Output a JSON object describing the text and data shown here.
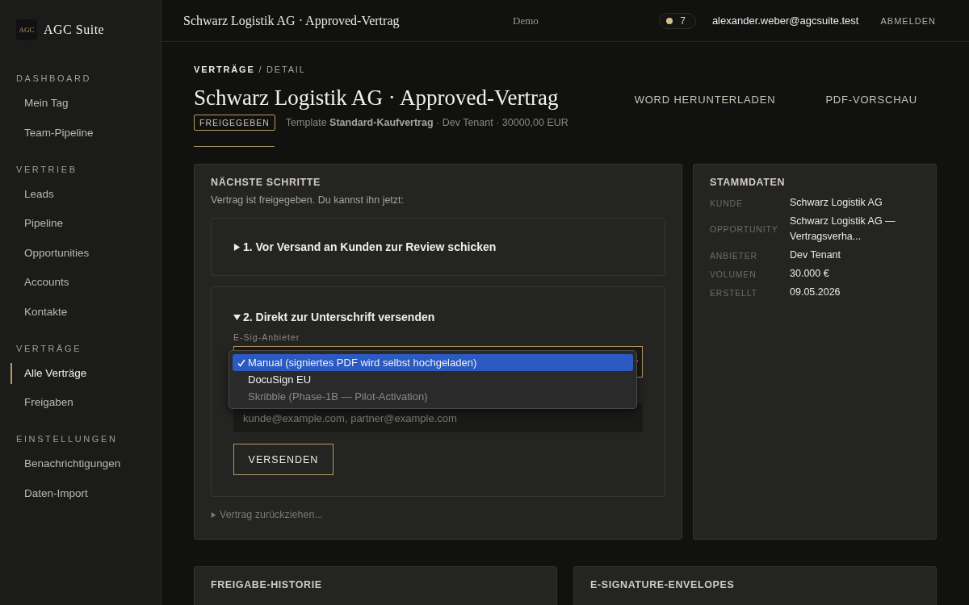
{
  "sidebar": {
    "logo_mark": "AGC",
    "brand": "AGC Suite",
    "sections": [
      {
        "title": "DASHBOARD",
        "items": [
          {
            "label": "Mein Tag",
            "selected": false
          },
          {
            "label": "Team-Pipeline",
            "selected": false
          }
        ]
      },
      {
        "title": "VERTRIEB",
        "items": [
          {
            "label": "Leads",
            "selected": false
          },
          {
            "label": "Pipeline",
            "selected": false
          },
          {
            "label": "Opportunities",
            "selected": false
          },
          {
            "label": "Accounts",
            "selected": false
          },
          {
            "label": "Kontakte",
            "selected": false
          }
        ]
      },
      {
        "title": "VERTRÄGE",
        "items": [
          {
            "label": "Alle Verträge",
            "selected": true
          },
          {
            "label": "Freigaben",
            "selected": false
          }
        ]
      },
      {
        "title": "EINSTELLUNGEN",
        "items": [
          {
            "label": "Benachrichtigungen",
            "selected": false
          },
          {
            "label": "Daten-Import",
            "selected": false
          }
        ]
      }
    ]
  },
  "topbar": {
    "title": "Schwarz Logistik AG · Approved-Vertrag",
    "environment": "Demo",
    "notifications": "7",
    "user": "alexander.weber@agcsuite.test",
    "logout": "ABMELDEN"
  },
  "header": {
    "breadcrumb": [
      "VERTRÄGE",
      "DETAIL"
    ],
    "breadcrumb_separator": "/",
    "title": "Schwarz Logistik AG · Approved-Vertrag",
    "status": "FREIGEGEBEN",
    "meta": "Template **Standard-Kaufvertrag** · Dev Tenant · 30000,00 EUR",
    "actions": [
      "WORD HERUNTERLADEN",
      "PDF-VORSCHAU"
    ]
  },
  "next_steps": {
    "title": "NÄCHSTE SCHRITTE",
    "intro": "Vertrag ist freigegeben. Du kannst ihn jetzt:",
    "steps": [
      {
        "label": "1. Vor Versand an Kunden zur Review schicken",
        "expanded": false
      },
      {
        "label": "2. Direkt zur Unterschrift versenden",
        "expanded": true,
        "provider_label": "E-Sig-Anbieter",
        "provider_options": [
          {
            "label": "Manual (signiertes PDF wird selbst hochgeladen)",
            "selected": true,
            "disabled": false
          },
          {
            "label": "DocuSign EU",
            "selected": false,
            "disabled": false
          },
          {
            "label": "Skribble (Phase-1B — Pilot-Activation)",
            "selected": false,
            "disabled": true
          }
        ],
        "recipients_placeholder": "kunde@example.com, partner@example.com",
        "send": "VERSENDEN"
      }
    ],
    "withdraw": {
      "label": "Vertrag zurückziehen..."
    }
  },
  "master_data": {
    "title": "STAMMDATEN",
    "rows": [
      {
        "label": "KUNDE",
        "value": "Schwarz Logistik AG"
      },
      {
        "label": "OPPORTUNITY",
        "value": "Schwarz Logistik AG — Vertragsverha..."
      },
      {
        "label": "ANBIETER",
        "value": "Dev Tenant"
      },
      {
        "label": "VOLUMEN",
        "value": "30.000 €"
      },
      {
        "label": "ERSTELLT",
        "value": "09.05.2026"
      }
    ]
  },
  "bottom_cards": [
    {
      "title": "FREIGABE-HISTORIE"
    },
    {
      "title": "E-SIGNATURE-ENVELOPES"
    }
  ]
}
